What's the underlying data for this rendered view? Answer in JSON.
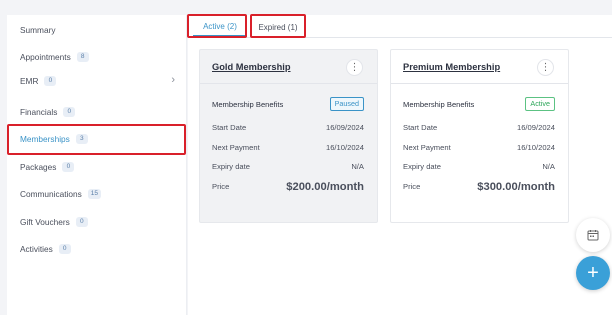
{
  "sidebar": {
    "items": [
      {
        "label": "Summary",
        "badge": null
      },
      {
        "label": "Appointments",
        "badge": "8"
      },
      {
        "label": "EMR",
        "badge": "0"
      },
      {
        "label": "Financials",
        "badge": "0"
      },
      {
        "label": "Memberships",
        "badge": "3"
      },
      {
        "label": "Packages",
        "badge": "0"
      },
      {
        "label": "Communications",
        "badge": "15"
      },
      {
        "label": "Gift Vouchers",
        "badge": "0"
      },
      {
        "label": "Activities",
        "badge": "0"
      }
    ],
    "active_item": "Memberships",
    "chevron_icon": "chevron-right-icon"
  },
  "tabs": [
    {
      "label": "Active (2)",
      "state": "active"
    },
    {
      "label": "Expired (1)",
      "state": "inactive"
    }
  ],
  "cards": [
    {
      "title": "Gold Membership",
      "menu_icon": "more-vertical-icon",
      "benefits_label": "Membership Benefits",
      "status": "Paused",
      "start_label": "Start Date",
      "start_value": "16/09/2024",
      "next_label": "Next Payment",
      "next_value": "16/10/2024",
      "expiry_label": "Expiry date",
      "expiry_value": "N/A",
      "price_label": "Price",
      "price_value": "$200.00/month"
    },
    {
      "title": "Premium Membership",
      "menu_icon": "more-vertical-icon",
      "benefits_label": "Membership Benefits",
      "status": "Active",
      "start_label": "Start Date",
      "start_value": "16/09/2024",
      "next_label": "Next Payment",
      "next_value": "16/10/2024",
      "expiry_label": "Expiry date",
      "expiry_value": "N/A",
      "price_label": "Price",
      "price_value": "$300.00/month"
    }
  ],
  "floating_buttons": {
    "calendar_icon": "calendar-icon",
    "add_icon": "plus-icon"
  },
  "colors": {
    "accent": "#3a93c7",
    "highlight": "#d9202a",
    "active_status": "#2ea65a",
    "fab": "#3aa0d8"
  }
}
